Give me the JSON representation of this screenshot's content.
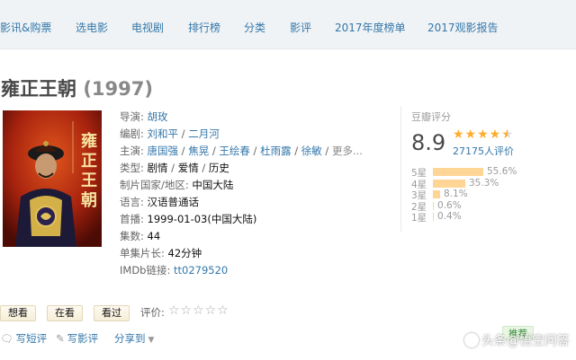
{
  "nav": {
    "items": [
      "影讯&购票",
      "选电影",
      "电视剧",
      "排行榜",
      "分类",
      "影评",
      "2017年度榜单",
      "2017观影报告"
    ]
  },
  "title": {
    "name": "雍正王朝",
    "year": "(1997)"
  },
  "poster": {
    "title_text": "雍正王朝",
    "subtitle": "雍正王朝",
    "accent_color": "#b8260f"
  },
  "info": {
    "director": {
      "label": "导演: ",
      "names": [
        "胡玫"
      ]
    },
    "writer": {
      "label": "编剧: ",
      "names": [
        "刘和平",
        "二月河"
      ]
    },
    "cast": {
      "label": "主演: ",
      "names": [
        "唐国强",
        "焦晃",
        "王绘春",
        "杜雨露",
        "徐敏"
      ],
      "more": "更多..."
    },
    "genre": {
      "label": "类型: ",
      "values": [
        "剧情",
        "爱情",
        "历史"
      ]
    },
    "country": {
      "label": "制片国家/地区: ",
      "value": "中国大陆"
    },
    "language": {
      "label": "语言: ",
      "value": "汉语普通话"
    },
    "premiere": {
      "label": "首播: ",
      "value": "1999-01-03(中国大陆)"
    },
    "episodes": {
      "label": "集数: ",
      "value": "44"
    },
    "runtime": {
      "label": "单集片长: ",
      "value": "42分钟"
    },
    "imdb": {
      "label": "IMDb链接: ",
      "value": "tt0279520"
    }
  },
  "rating": {
    "label": "豆瓣评分",
    "score": "8.9",
    "stars": "★★★★",
    "votes_text": "27175人评价",
    "histogram": [
      {
        "label": "5星",
        "percent": 55.6,
        "text": "55.6%"
      },
      {
        "label": "4星",
        "percent": 35.3,
        "text": "35.3%"
      },
      {
        "label": "3星",
        "percent": 8.1,
        "text": "8.1%"
      },
      {
        "label": "2星",
        "percent": 0.6,
        "text": "0.6%"
      },
      {
        "label": "1星",
        "percent": 0.4,
        "text": "0.4%"
      }
    ]
  },
  "actions": {
    "want": "想看",
    "watching": "在看",
    "watched": "看过",
    "rate_label": "评价:",
    "empty_stars": "☆☆☆☆☆",
    "short_review": "写短评",
    "review": "写影评",
    "share": "分享到",
    "recommend": "推荐"
  },
  "watermark": "头条@悟空问答"
}
